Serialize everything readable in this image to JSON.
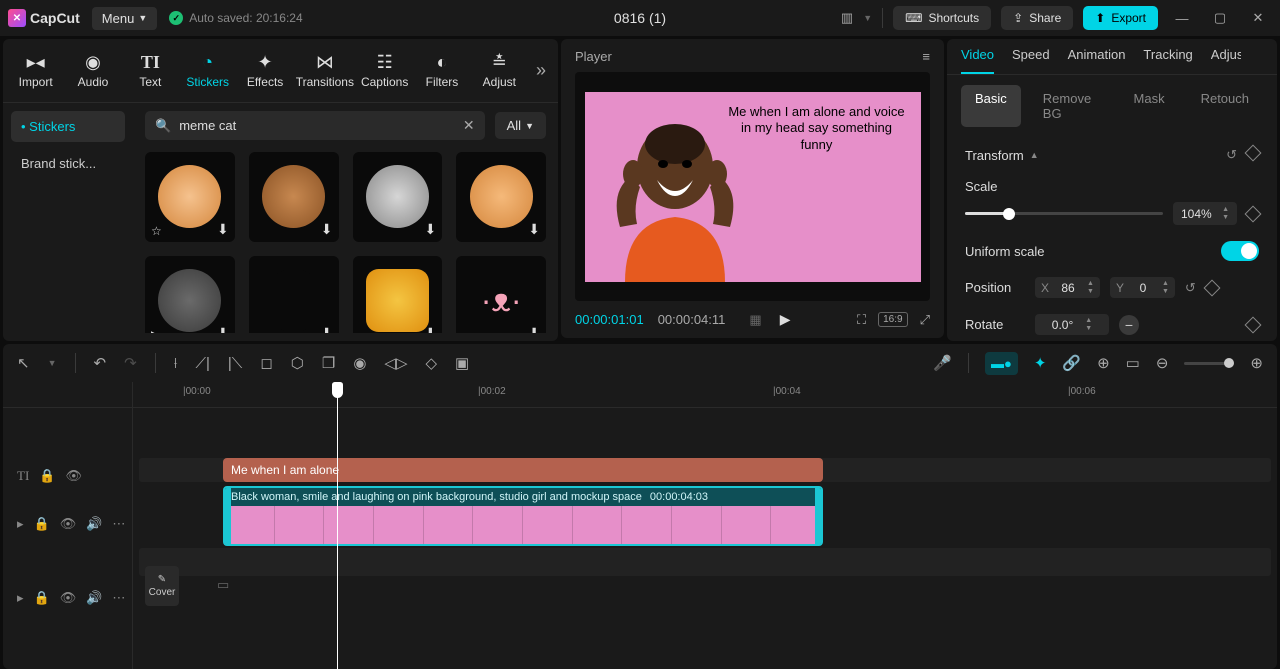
{
  "app": {
    "name": "CapCut",
    "menu": "Menu",
    "autosaved": "Auto saved: 20:16:24",
    "title": "0816 (1)"
  },
  "titlebar": {
    "shortcuts": "Shortcuts",
    "share": "Share",
    "export": "Export"
  },
  "tools": {
    "items": [
      {
        "label": "Import"
      },
      {
        "label": "Audio"
      },
      {
        "label": "Text"
      },
      {
        "label": "Stickers"
      },
      {
        "label": "Effects"
      },
      {
        "label": "Transitions"
      },
      {
        "label": "Captions"
      },
      {
        "label": "Filters"
      },
      {
        "label": "Adjust"
      }
    ],
    "active": 3
  },
  "stickers": {
    "sidebar": [
      {
        "label": "Stickers",
        "active": true
      },
      {
        "label": "Brand stick...",
        "active": false
      }
    ],
    "search": "meme cat",
    "all": "All"
  },
  "player": {
    "label": "Player",
    "meme_text": "Me when I am alone and voice in my head say something funny",
    "current": "00:00:01:01",
    "duration": "00:00:04:11",
    "ratio": "16:9"
  },
  "inspector": {
    "tabs": [
      "Video",
      "Speed",
      "Animation",
      "Tracking",
      "Adjust"
    ],
    "active_tab": 0,
    "subtabs": [
      "Basic",
      "Remove BG",
      "Mask",
      "Retouch"
    ],
    "active_sub": 0,
    "transform_label": "Transform",
    "scale_label": "Scale",
    "scale_value": "104%",
    "scale_pct": 22,
    "uniform_label": "Uniform scale",
    "position_label": "Position",
    "pos_x": "86",
    "pos_y": "0",
    "rotate_label": "Rotate",
    "rotate_value": "0.0°"
  },
  "timeline": {
    "marks": [
      "00:00",
      "00:02",
      "00:04",
      "00:06"
    ],
    "text_clip": "Me when I am alone",
    "video_clip_name": "Black woman, smile and laughing on pink background, studio girl and mockup space",
    "video_clip_dur": "00:00:04:03",
    "cover": "Cover"
  }
}
